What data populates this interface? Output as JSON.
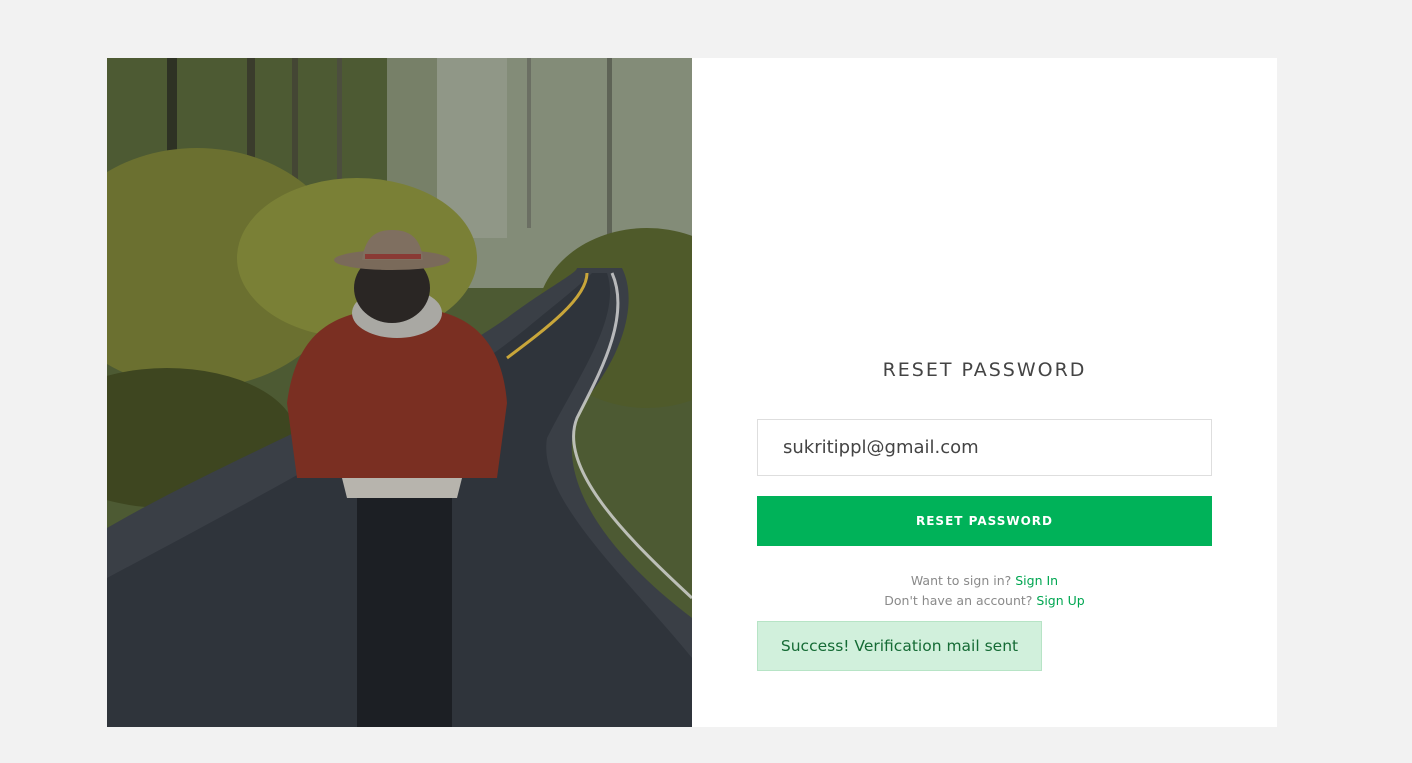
{
  "form": {
    "title": "RESET PASSWORD",
    "email_value": "sukritippl@gmail.com",
    "submit_label": "RESET PASSWORD"
  },
  "links": {
    "signin_prompt": "Want to sign in?",
    "signin_label": "Sign In",
    "signup_prompt": "Don't have an account?",
    "signup_label": "Sign Up"
  },
  "alert": {
    "message": "Success! Verification mail sent"
  },
  "colors": {
    "accent": "#00b259",
    "link": "#00a651",
    "alert_bg": "#d1f0dc",
    "alert_text": "#156b35",
    "page_bg": "#f2f2f2"
  }
}
